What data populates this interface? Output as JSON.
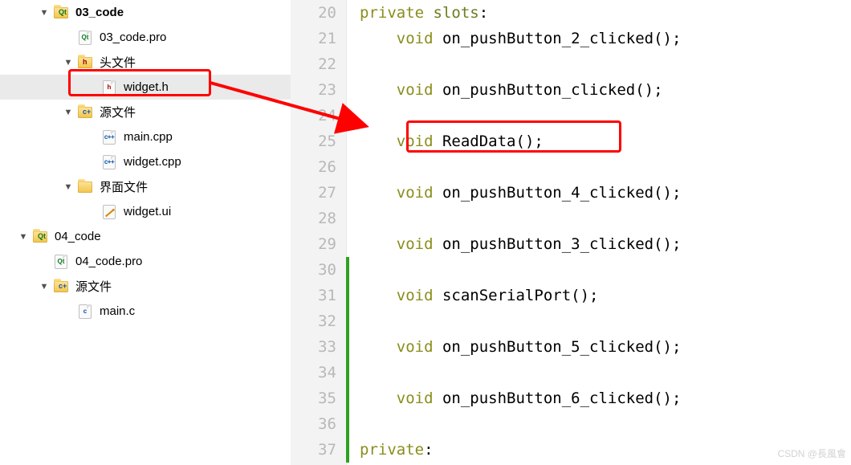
{
  "tree": [
    {
      "d": 1,
      "arrow": "▼",
      "icon": "folder-qt",
      "label": "03_code",
      "bold": true
    },
    {
      "d": 2,
      "arrow": "",
      "icon": "file-qt",
      "label": "03_code.pro"
    },
    {
      "d": 2,
      "arrow": "▼",
      "icon": "folder-h",
      "label": "头文件"
    },
    {
      "d": 3,
      "arrow": "",
      "icon": "file-h",
      "label": "widget.h",
      "selected": true
    },
    {
      "d": 2,
      "arrow": "▼",
      "icon": "folder-cpp",
      "label": "源文件"
    },
    {
      "d": 3,
      "arrow": "",
      "icon": "file-cpp",
      "label": "main.cpp"
    },
    {
      "d": 3,
      "arrow": "",
      "icon": "file-cpp",
      "label": "widget.cpp"
    },
    {
      "d": 2,
      "arrow": "▼",
      "icon": "folder-ui",
      "label": "界面文件"
    },
    {
      "d": 3,
      "arrow": "",
      "icon": "file-ui",
      "label": "widget.ui"
    },
    {
      "d": 0,
      "arrow": "▼",
      "icon": "folder-qt",
      "label": "04_code"
    },
    {
      "d": 1,
      "arrow": "",
      "icon": "file-qt",
      "label": "04_code.pro"
    },
    {
      "d": 1,
      "arrow": "▼",
      "icon": "folder-cpp",
      "label": "源文件"
    },
    {
      "d": 2,
      "arrow": "",
      "icon": "file-c",
      "label": "main.c"
    }
  ],
  "code_lines": [
    {
      "n": 20,
      "indent": 0,
      "tokens": [
        [
          "kw",
          "private"
        ],
        [
          "pn",
          " "
        ],
        [
          "sl",
          "slots"
        ],
        [
          "pn",
          ":"
        ]
      ]
    },
    {
      "n": 21,
      "indent": 1,
      "tokens": [
        [
          "ty",
          "void"
        ],
        [
          "pn",
          " "
        ],
        [
          "fn",
          "on_pushButton_2_clicked"
        ],
        [
          "pn",
          "();"
        ]
      ]
    },
    {
      "n": 22,
      "indent": 0,
      "tokens": []
    },
    {
      "n": 23,
      "indent": 1,
      "tokens": [
        [
          "ty",
          "void"
        ],
        [
          "pn",
          " "
        ],
        [
          "fn",
          "on_pushButton_clicked"
        ],
        [
          "pn",
          "();"
        ]
      ]
    },
    {
      "n": 24,
      "indent": 0,
      "tokens": []
    },
    {
      "n": 25,
      "indent": 1,
      "tokens": [
        [
          "ty",
          "void"
        ],
        [
          "pn",
          " "
        ],
        [
          "fn",
          "ReadData"
        ],
        [
          "pn",
          "();"
        ]
      ]
    },
    {
      "n": 26,
      "indent": 0,
      "tokens": []
    },
    {
      "n": 27,
      "indent": 1,
      "tokens": [
        [
          "ty",
          "void"
        ],
        [
          "pn",
          " "
        ],
        [
          "fn",
          "on_pushButton_4_clicked"
        ],
        [
          "pn",
          "();"
        ]
      ]
    },
    {
      "n": 28,
      "indent": 0,
      "tokens": []
    },
    {
      "n": 29,
      "indent": 1,
      "tokens": [
        [
          "ty",
          "void"
        ],
        [
          "pn",
          " "
        ],
        [
          "fn",
          "on_pushButton_3_clicked"
        ],
        [
          "pn",
          "();"
        ]
      ]
    },
    {
      "n": 30,
      "indent": 0,
      "tokens": []
    },
    {
      "n": 31,
      "indent": 1,
      "tokens": [
        [
          "ty",
          "void"
        ],
        [
          "pn",
          " "
        ],
        [
          "fn",
          "scanSerialPort"
        ],
        [
          "pn",
          "();"
        ]
      ]
    },
    {
      "n": 32,
      "indent": 0,
      "tokens": []
    },
    {
      "n": 33,
      "indent": 1,
      "tokens": [
        [
          "ty",
          "void"
        ],
        [
          "pn",
          " "
        ],
        [
          "fn",
          "on_pushButton_5_clicked"
        ],
        [
          "pn",
          "();"
        ]
      ]
    },
    {
      "n": 34,
      "indent": 0,
      "tokens": []
    },
    {
      "n": 35,
      "indent": 1,
      "tokens": [
        [
          "ty",
          "void"
        ],
        [
          "pn",
          " "
        ],
        [
          "fn",
          "on_pushButton_6_clicked"
        ],
        [
          "pn",
          "();"
        ]
      ]
    },
    {
      "n": 36,
      "indent": 0,
      "tokens": []
    },
    {
      "n": 37,
      "indent": 0,
      "tokens": [
        [
          "kw",
          "private"
        ],
        [
          "pn",
          ":"
        ]
      ]
    }
  ],
  "marker": {
    "start": 30,
    "end": 37
  },
  "watermark": "CSDN @長風會"
}
